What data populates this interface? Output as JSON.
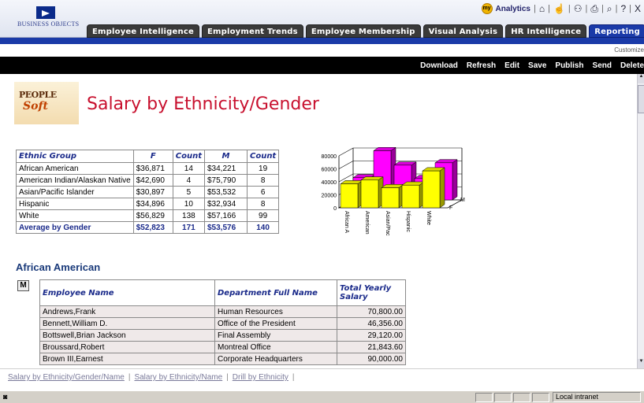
{
  "header": {
    "logo_text": "BUSINESS OBJECTS",
    "brand_my": "my",
    "brand_text": "Analytics",
    "icons": [
      "home-icon",
      "hand-icon",
      "people-icon",
      "printer-icon",
      "search-icon",
      "help-icon",
      "close-icon"
    ],
    "icon_glyphs": [
      "⌂",
      "☝",
      "⚇",
      "⎙",
      "⌕",
      "?",
      "X"
    ],
    "tabs": [
      {
        "label": "Employee Intelligence",
        "active": false
      },
      {
        "label": "Employment Trends",
        "active": false
      },
      {
        "label": "Employee Membership",
        "active": false
      },
      {
        "label": "Visual Analysis",
        "active": false
      },
      {
        "label": "HR Intelligence",
        "active": false
      },
      {
        "label": "Reporting",
        "active": true
      }
    ],
    "customize_label": "Customize",
    "menu": [
      "Download",
      "Refresh",
      "Edit",
      "Save",
      "Publish",
      "Send",
      "Delete"
    ]
  },
  "report": {
    "logo_line1": "PEOPLE",
    "logo_line2": "Soft",
    "title": "Salary by Ethnicity/Gender",
    "summary": {
      "headers": [
        "Ethnic Group",
        "F",
        "Count",
        "M",
        "Count"
      ],
      "rows": [
        [
          "African American",
          "$36,871",
          "14",
          "$34,221",
          "19"
        ],
        [
          "American Indian/Alaskan Native",
          "$42,690",
          "4",
          "$75,790",
          "8"
        ],
        [
          "Asian/Pacific Islander",
          "$30,897",
          "5",
          "$53,532",
          "6"
        ],
        [
          "Hispanic",
          "$34,896",
          "10",
          "$32,934",
          "8"
        ],
        [
          "White",
          "$56,829",
          "138",
          "$57,166",
          "99"
        ]
      ],
      "average": [
        "Average by Gender",
        "$52,823",
        "171",
        "$53,576",
        "140"
      ]
    },
    "section_title": "African American",
    "gender_toggle": "M",
    "detail": {
      "headers": [
        "Employee Name",
        "Department Full Name",
        "Total Yearly Salary"
      ],
      "rows": [
        [
          "Andrews,Frank",
          "Human Resources",
          "70,800.00"
        ],
        [
          "Bennett,William D.",
          "Office of the President",
          "46,356.00"
        ],
        [
          "Bottswell,Brian Jackson",
          "Final Assembly",
          "29,120.00"
        ],
        [
          "Broussard,Robert",
          "Montreal Office",
          "21,843.60"
        ],
        [
          "Brown III,Earnest",
          "Corporate Headquarters",
          "90,000.00"
        ]
      ]
    }
  },
  "chart_data": {
    "type": "bar",
    "categories": [
      "African A",
      "American",
      "Asian/Pac",
      "Hispanic",
      "White"
    ],
    "series": [
      {
        "name": "F",
        "values": [
          36871,
          42690,
          30897,
          34896,
          56829
        ],
        "color": "#ffff00"
      },
      {
        "name": "M",
        "values": [
          34221,
          75790,
          53532,
          32934,
          57166
        ],
        "color": "#ff00ff"
      }
    ],
    "yticks": [
      "80000",
      "60000",
      "40000",
      "20000",
      "0"
    ],
    "ylim": [
      0,
      80000
    ],
    "grid": true
  },
  "footer": {
    "links": [
      "Salary by Ethnicity/Gender/Name",
      "Salary by Ethnicity/Name",
      "Drill by Ethnicity"
    ],
    "pipe": "|"
  },
  "status": {
    "zone": "Local intranet"
  },
  "colors": {
    "title": "#c8102e",
    "header_blue": "#1a3aa8",
    "table_header": "#1a2a8a"
  }
}
